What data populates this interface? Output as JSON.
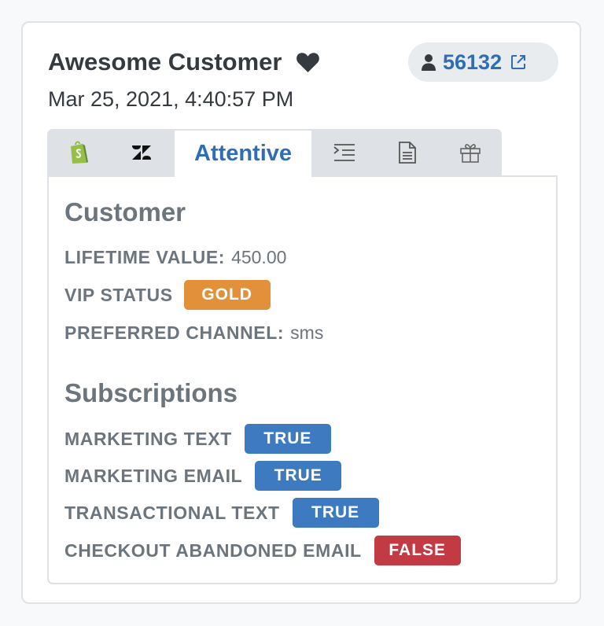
{
  "header": {
    "customer_name": "Awesome Customer",
    "timestamp": "Mar 25, 2021, 4:40:57 PM",
    "favorite_icon": "heart-icon",
    "customer_id": "56132"
  },
  "tabs": [
    {
      "icon": "shopify-icon"
    },
    {
      "icon": "zendesk-icon"
    },
    {
      "label": "Attentive",
      "active": true
    },
    {
      "icon": "indent-list-icon"
    },
    {
      "icon": "document-icon"
    },
    {
      "icon": "gift-icon"
    }
  ],
  "customer": {
    "heading": "Customer",
    "lifetime_value_label": "LIFETIME VALUE:",
    "lifetime_value": "450.00",
    "vip_status_label": "VIP STATUS",
    "vip_status": "GOLD",
    "preferred_channel_label": "PREFERRED CHANNEL:",
    "preferred_channel": "sms"
  },
  "subscriptions": {
    "heading": "Subscriptions",
    "items": [
      {
        "label": "MARKETING TEXT",
        "value": "TRUE"
      },
      {
        "label": "MARKETING EMAIL",
        "value": "TRUE"
      },
      {
        "label": "TRANSACTIONAL TEXT",
        "value": "TRUE"
      },
      {
        "label": "CHECKOUT ABANDONED EMAIL",
        "value": "FALSE"
      }
    ]
  },
  "colors": {
    "accent": "#2f6eb5",
    "true_badge": "#3d7abf",
    "false_badge": "#c13a44",
    "gold_badge": "#e2913a"
  }
}
